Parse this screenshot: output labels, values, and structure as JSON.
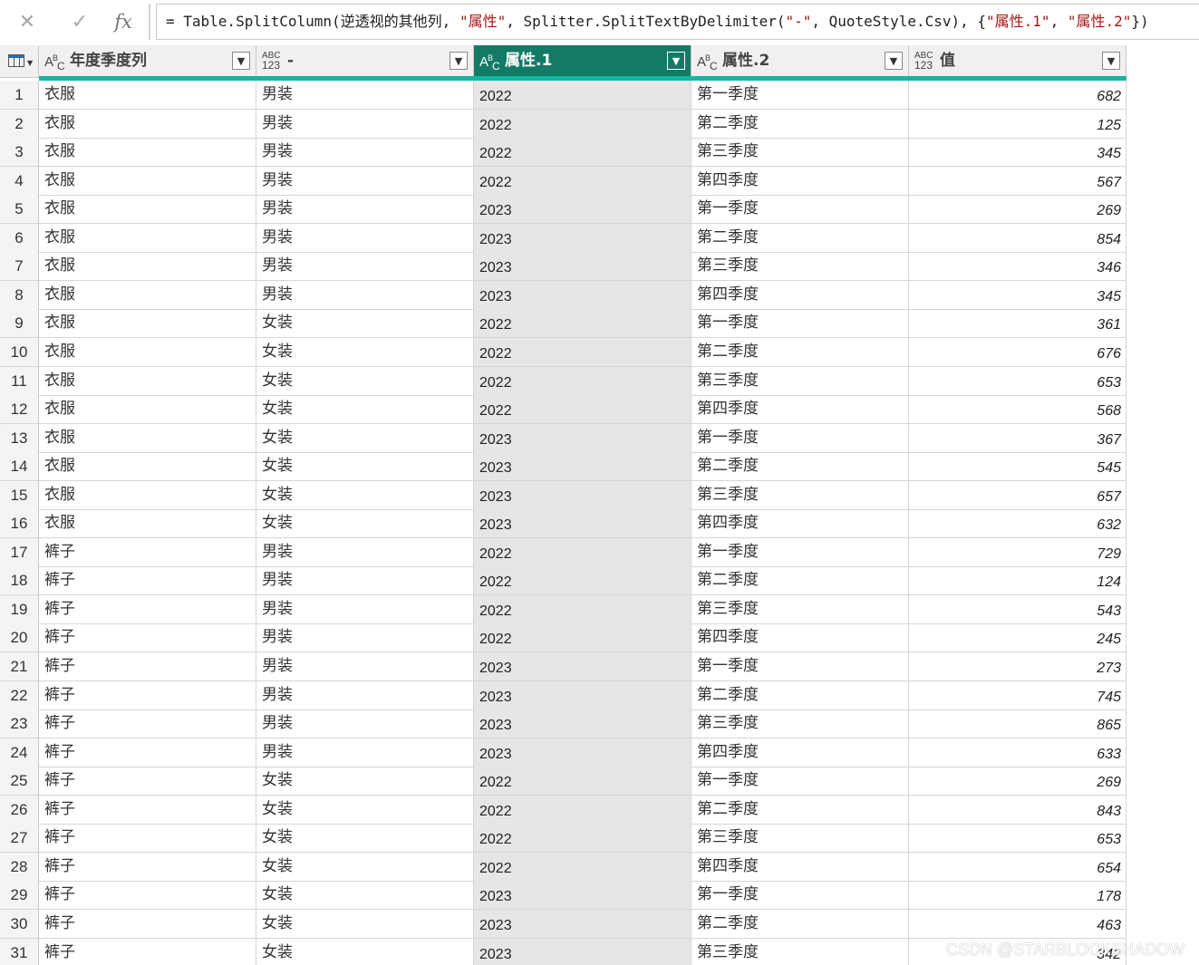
{
  "formula_bar": {
    "cancel_icon": "close-icon",
    "commit_icon": "check-icon",
    "fx_label": "fx",
    "formula_parts": [
      {
        "text": "= Table.SplitColumn(逆透视的其他列, ",
        "kind": "plain"
      },
      {
        "text": "\"属性\"",
        "kind": "str"
      },
      {
        "text": ", Splitter.SplitTextByDelimiter(",
        "kind": "plain"
      },
      {
        "text": "\"-\"",
        "kind": "str"
      },
      {
        "text": ", QuoteStyle.Csv), {",
        "kind": "plain"
      },
      {
        "text": "\"属性.1\"",
        "kind": "str"
      },
      {
        "text": ", ",
        "kind": "plain"
      },
      {
        "text": "\"属性.2\"",
        "kind": "str"
      },
      {
        "text": "})",
        "kind": "plain"
      }
    ]
  },
  "grid": {
    "table_icon": "table-icon",
    "selected_color": "#137a65",
    "quality_bar_color": "#13b6a0",
    "columns": [
      {
        "type_icon": "ABC",
        "type_kind": "text",
        "label": "年度季度列",
        "selected": false
      },
      {
        "type_icon": "ABC123",
        "type_kind": "any",
        "label": "-",
        "selected": false
      },
      {
        "type_icon": "ABC",
        "type_kind": "text",
        "label": "属性.1",
        "selected": true
      },
      {
        "type_icon": "ABC",
        "type_kind": "text",
        "label": "属性.2",
        "selected": false
      },
      {
        "type_icon": "ABC123",
        "type_kind": "any",
        "label": "值",
        "selected": false
      }
    ],
    "rows": [
      [
        "1",
        "衣服",
        "男装",
        "2022",
        "第一季度",
        "682"
      ],
      [
        "2",
        "衣服",
        "男装",
        "2022",
        "第二季度",
        "125"
      ],
      [
        "3",
        "衣服",
        "男装",
        "2022",
        "第三季度",
        "345"
      ],
      [
        "4",
        "衣服",
        "男装",
        "2022",
        "第四季度",
        "567"
      ],
      [
        "5",
        "衣服",
        "男装",
        "2023",
        "第一季度",
        "269"
      ],
      [
        "6",
        "衣服",
        "男装",
        "2023",
        "第二季度",
        "854"
      ],
      [
        "7",
        "衣服",
        "男装",
        "2023",
        "第三季度",
        "346"
      ],
      [
        "8",
        "衣服",
        "男装",
        "2023",
        "第四季度",
        "345"
      ],
      [
        "9",
        "衣服",
        "女装",
        "2022",
        "第一季度",
        "361"
      ],
      [
        "10",
        "衣服",
        "女装",
        "2022",
        "第二季度",
        "676"
      ],
      [
        "11",
        "衣服",
        "女装",
        "2022",
        "第三季度",
        "653"
      ],
      [
        "12",
        "衣服",
        "女装",
        "2022",
        "第四季度",
        "568"
      ],
      [
        "13",
        "衣服",
        "女装",
        "2023",
        "第一季度",
        "367"
      ],
      [
        "14",
        "衣服",
        "女装",
        "2023",
        "第二季度",
        "545"
      ],
      [
        "15",
        "衣服",
        "女装",
        "2023",
        "第三季度",
        "657"
      ],
      [
        "16",
        "衣服",
        "女装",
        "2023",
        "第四季度",
        "632"
      ],
      [
        "17",
        "裤子",
        "男装",
        "2022",
        "第一季度",
        "729"
      ],
      [
        "18",
        "裤子",
        "男装",
        "2022",
        "第二季度",
        "124"
      ],
      [
        "19",
        "裤子",
        "男装",
        "2022",
        "第三季度",
        "543"
      ],
      [
        "20",
        "裤子",
        "男装",
        "2022",
        "第四季度",
        "245"
      ],
      [
        "21",
        "裤子",
        "男装",
        "2023",
        "第一季度",
        "273"
      ],
      [
        "22",
        "裤子",
        "男装",
        "2023",
        "第二季度",
        "745"
      ],
      [
        "23",
        "裤子",
        "男装",
        "2023",
        "第三季度",
        "865"
      ],
      [
        "24",
        "裤子",
        "男装",
        "2023",
        "第四季度",
        "633"
      ],
      [
        "25",
        "裤子",
        "女装",
        "2022",
        "第一季度",
        "269"
      ],
      [
        "26",
        "裤子",
        "女装",
        "2022",
        "第二季度",
        "843"
      ],
      [
        "27",
        "裤子",
        "女装",
        "2022",
        "第三季度",
        "653"
      ],
      [
        "28",
        "裤子",
        "女装",
        "2022",
        "第四季度",
        "654"
      ],
      [
        "29",
        "裤子",
        "女装",
        "2023",
        "第一季度",
        "178"
      ],
      [
        "30",
        "裤子",
        "女装",
        "2023",
        "第二季度",
        "463"
      ],
      [
        "31",
        "裤子",
        "女装",
        "2023",
        "第三季度",
        "342"
      ]
    ]
  },
  "watermark": "CSDN @STARBLOCKSHADOW"
}
